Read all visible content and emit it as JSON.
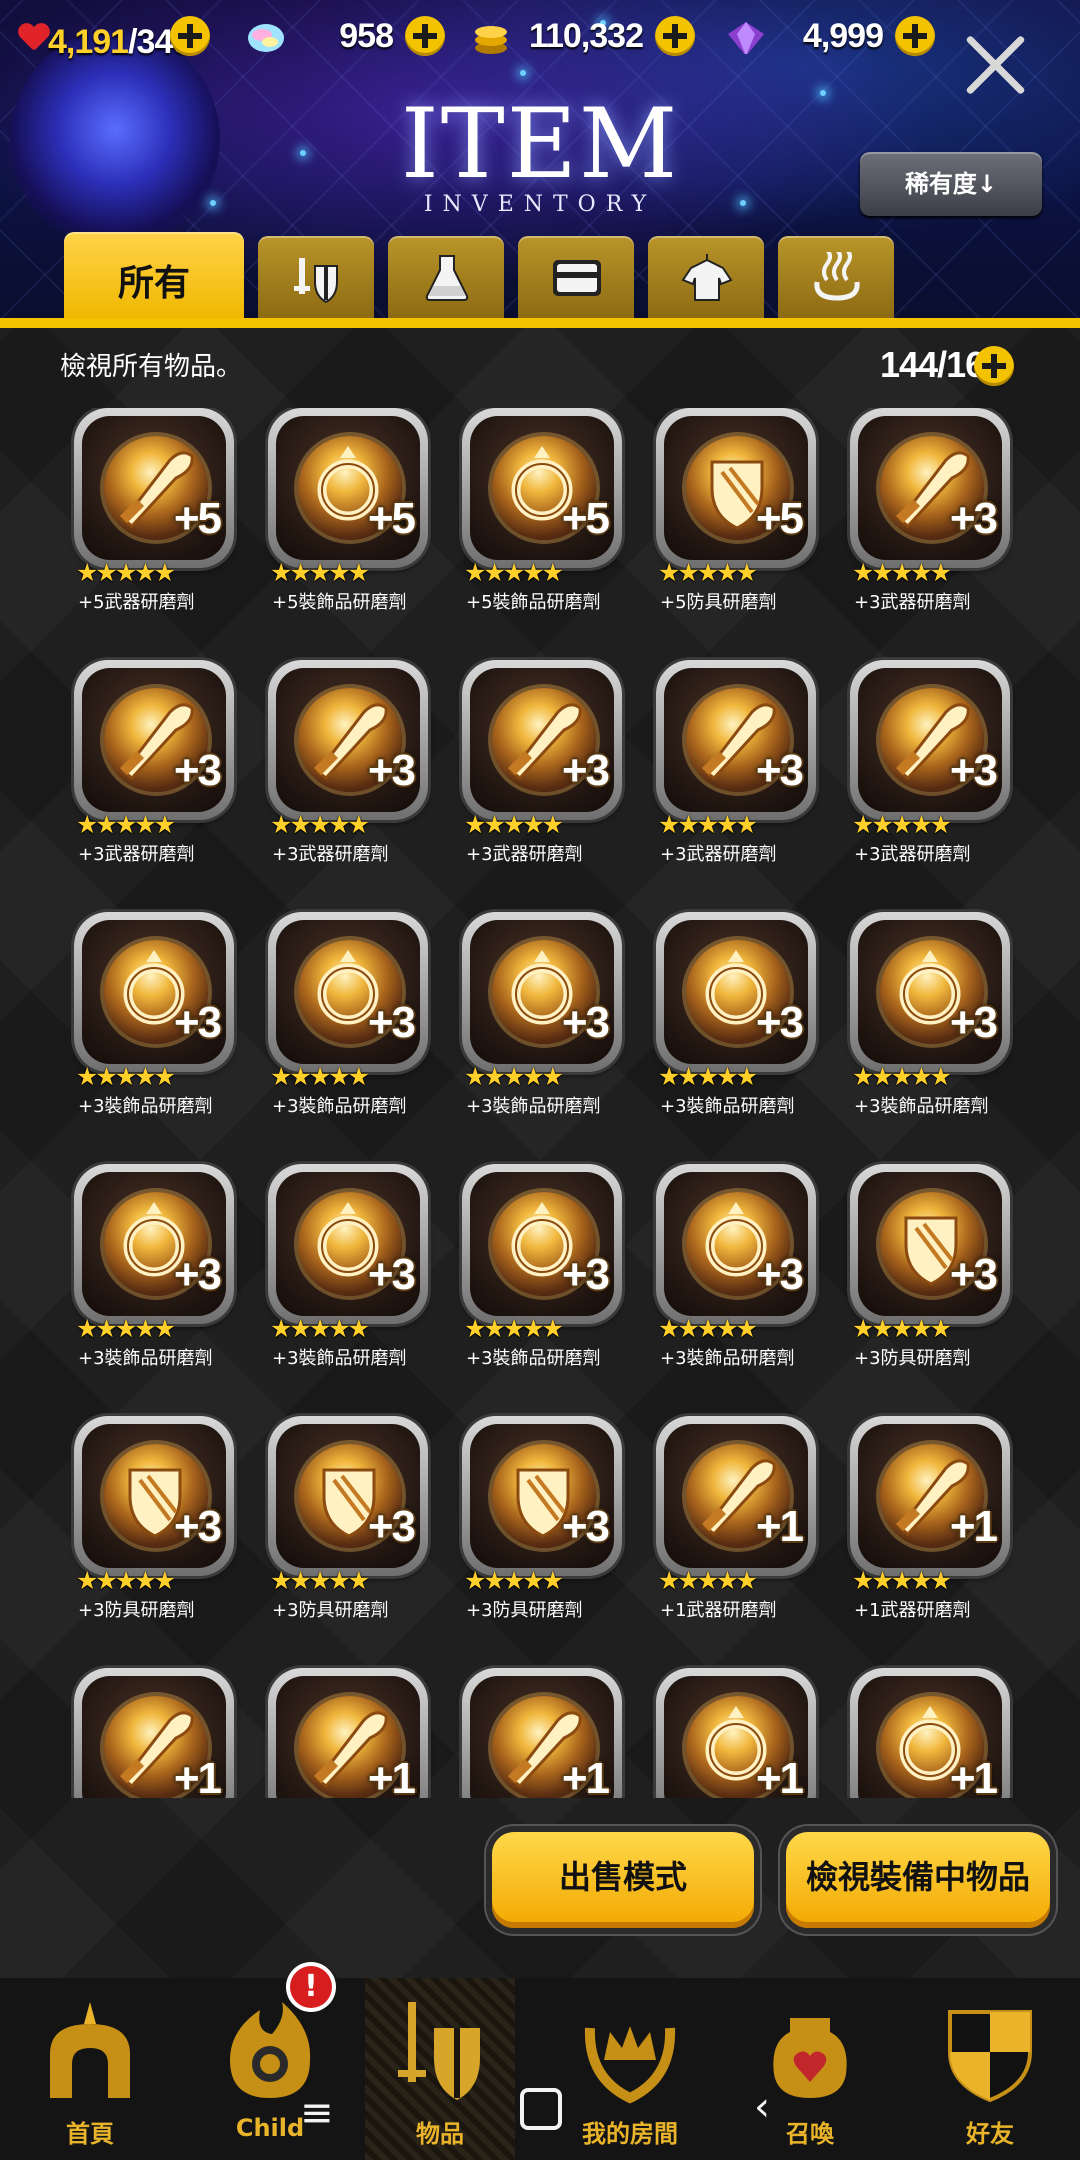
{
  "resources": {
    "stamina_current": "4,191",
    "stamina_max": "/346",
    "gems": "958",
    "coins": "110,332",
    "crystals": "4,999"
  },
  "header": {
    "title": "ITEM",
    "subtitle": "INVENTORY",
    "sort_label": "稀有度↓"
  },
  "tabs": [
    {
      "label": "所有",
      "icon": "all",
      "active": true
    },
    {
      "label": "",
      "icon": "equipment-icon"
    },
    {
      "label": "",
      "icon": "potion-flask-icon"
    },
    {
      "label": "",
      "icon": "card-icon"
    },
    {
      "label": "",
      "icon": "costume-shirt-icon"
    },
    {
      "label": "",
      "icon": "hot-spring-icon"
    }
  ],
  "content": {
    "description": "檢視所有物品。",
    "capacity": "144/160"
  },
  "items": [
    {
      "name": "+5武器研磨劑",
      "level": "+5",
      "type": "weapon",
      "stars": 5
    },
    {
      "name": "+5裝飾品研磨劑",
      "level": "+5",
      "type": "accessory",
      "stars": 5
    },
    {
      "name": "+5裝飾品研磨劑",
      "level": "+5",
      "type": "accessory",
      "stars": 5
    },
    {
      "name": "+5防具研磨劑",
      "level": "+5",
      "type": "armor",
      "stars": 5
    },
    {
      "name": "+3武器研磨劑",
      "level": "+3",
      "type": "weapon",
      "stars": 5
    },
    {
      "name": "+3武器研磨劑",
      "level": "+3",
      "type": "weapon",
      "stars": 5
    },
    {
      "name": "+3武器研磨劑",
      "level": "+3",
      "type": "weapon",
      "stars": 5
    },
    {
      "name": "+3武器研磨劑",
      "level": "+3",
      "type": "weapon",
      "stars": 5
    },
    {
      "name": "+3武器研磨劑",
      "level": "+3",
      "type": "weapon",
      "stars": 5
    },
    {
      "name": "+3武器研磨劑",
      "level": "+3",
      "type": "weapon",
      "stars": 5
    },
    {
      "name": "+3裝飾品研磨劑",
      "level": "+3",
      "type": "accessory",
      "stars": 5
    },
    {
      "name": "+3裝飾品研磨劑",
      "level": "+3",
      "type": "accessory",
      "stars": 5
    },
    {
      "name": "+3裝飾品研磨劑",
      "level": "+3",
      "type": "accessory",
      "stars": 5
    },
    {
      "name": "+3裝飾品研磨劑",
      "level": "+3",
      "type": "accessory",
      "stars": 5
    },
    {
      "name": "+3裝飾品研磨劑",
      "level": "+3",
      "type": "accessory",
      "stars": 5
    },
    {
      "name": "+3裝飾品研磨劑",
      "level": "+3",
      "type": "accessory",
      "stars": 5
    },
    {
      "name": "+3裝飾品研磨劑",
      "level": "+3",
      "type": "accessory",
      "stars": 5
    },
    {
      "name": "+3裝飾品研磨劑",
      "level": "+3",
      "type": "accessory",
      "stars": 5
    },
    {
      "name": "+3裝飾品研磨劑",
      "level": "+3",
      "type": "accessory",
      "stars": 5
    },
    {
      "name": "+3防具研磨劑",
      "level": "+3",
      "type": "armor",
      "stars": 5
    },
    {
      "name": "+3防具研磨劑",
      "level": "+3",
      "type": "armor",
      "stars": 5
    },
    {
      "name": "+3防具研磨劑",
      "level": "+3",
      "type": "armor",
      "stars": 5
    },
    {
      "name": "+3防具研磨劑",
      "level": "+3",
      "type": "armor",
      "stars": 5
    },
    {
      "name": "+1武器研磨劑",
      "level": "+1",
      "type": "weapon",
      "stars": 5
    },
    {
      "name": "+1武器研磨劑",
      "level": "+1",
      "type": "weapon",
      "stars": 5
    },
    {
      "name": "",
      "level": "+1",
      "type": "weapon",
      "stars": 0
    },
    {
      "name": "",
      "level": "+1",
      "type": "weapon",
      "stars": 0
    },
    {
      "name": "",
      "level": "+1",
      "type": "weapon",
      "stars": 0
    },
    {
      "name": "",
      "level": "+1",
      "type": "accessory",
      "stars": 0
    },
    {
      "name": "",
      "level": "+1",
      "type": "accessory",
      "stars": 0
    }
  ],
  "actions": {
    "sell_mode": "出售模式",
    "view_equipped": "檢視裝備中物品"
  },
  "nav": [
    {
      "label": "首頁",
      "icon": "home-icon"
    },
    {
      "label": "Child",
      "icon": "child-icon"
    },
    {
      "label": "物品",
      "icon": "items-icon"
    },
    {
      "label": "我的房間",
      "icon": "my-room-icon"
    },
    {
      "label": "召喚",
      "icon": "summon-icon"
    },
    {
      "label": "好友",
      "icon": "friends-icon"
    }
  ],
  "alert_badge": "!",
  "colors": {
    "accent": "#f3c300",
    "nav_label": "#e9b42a",
    "star": "#ffcf2a"
  }
}
